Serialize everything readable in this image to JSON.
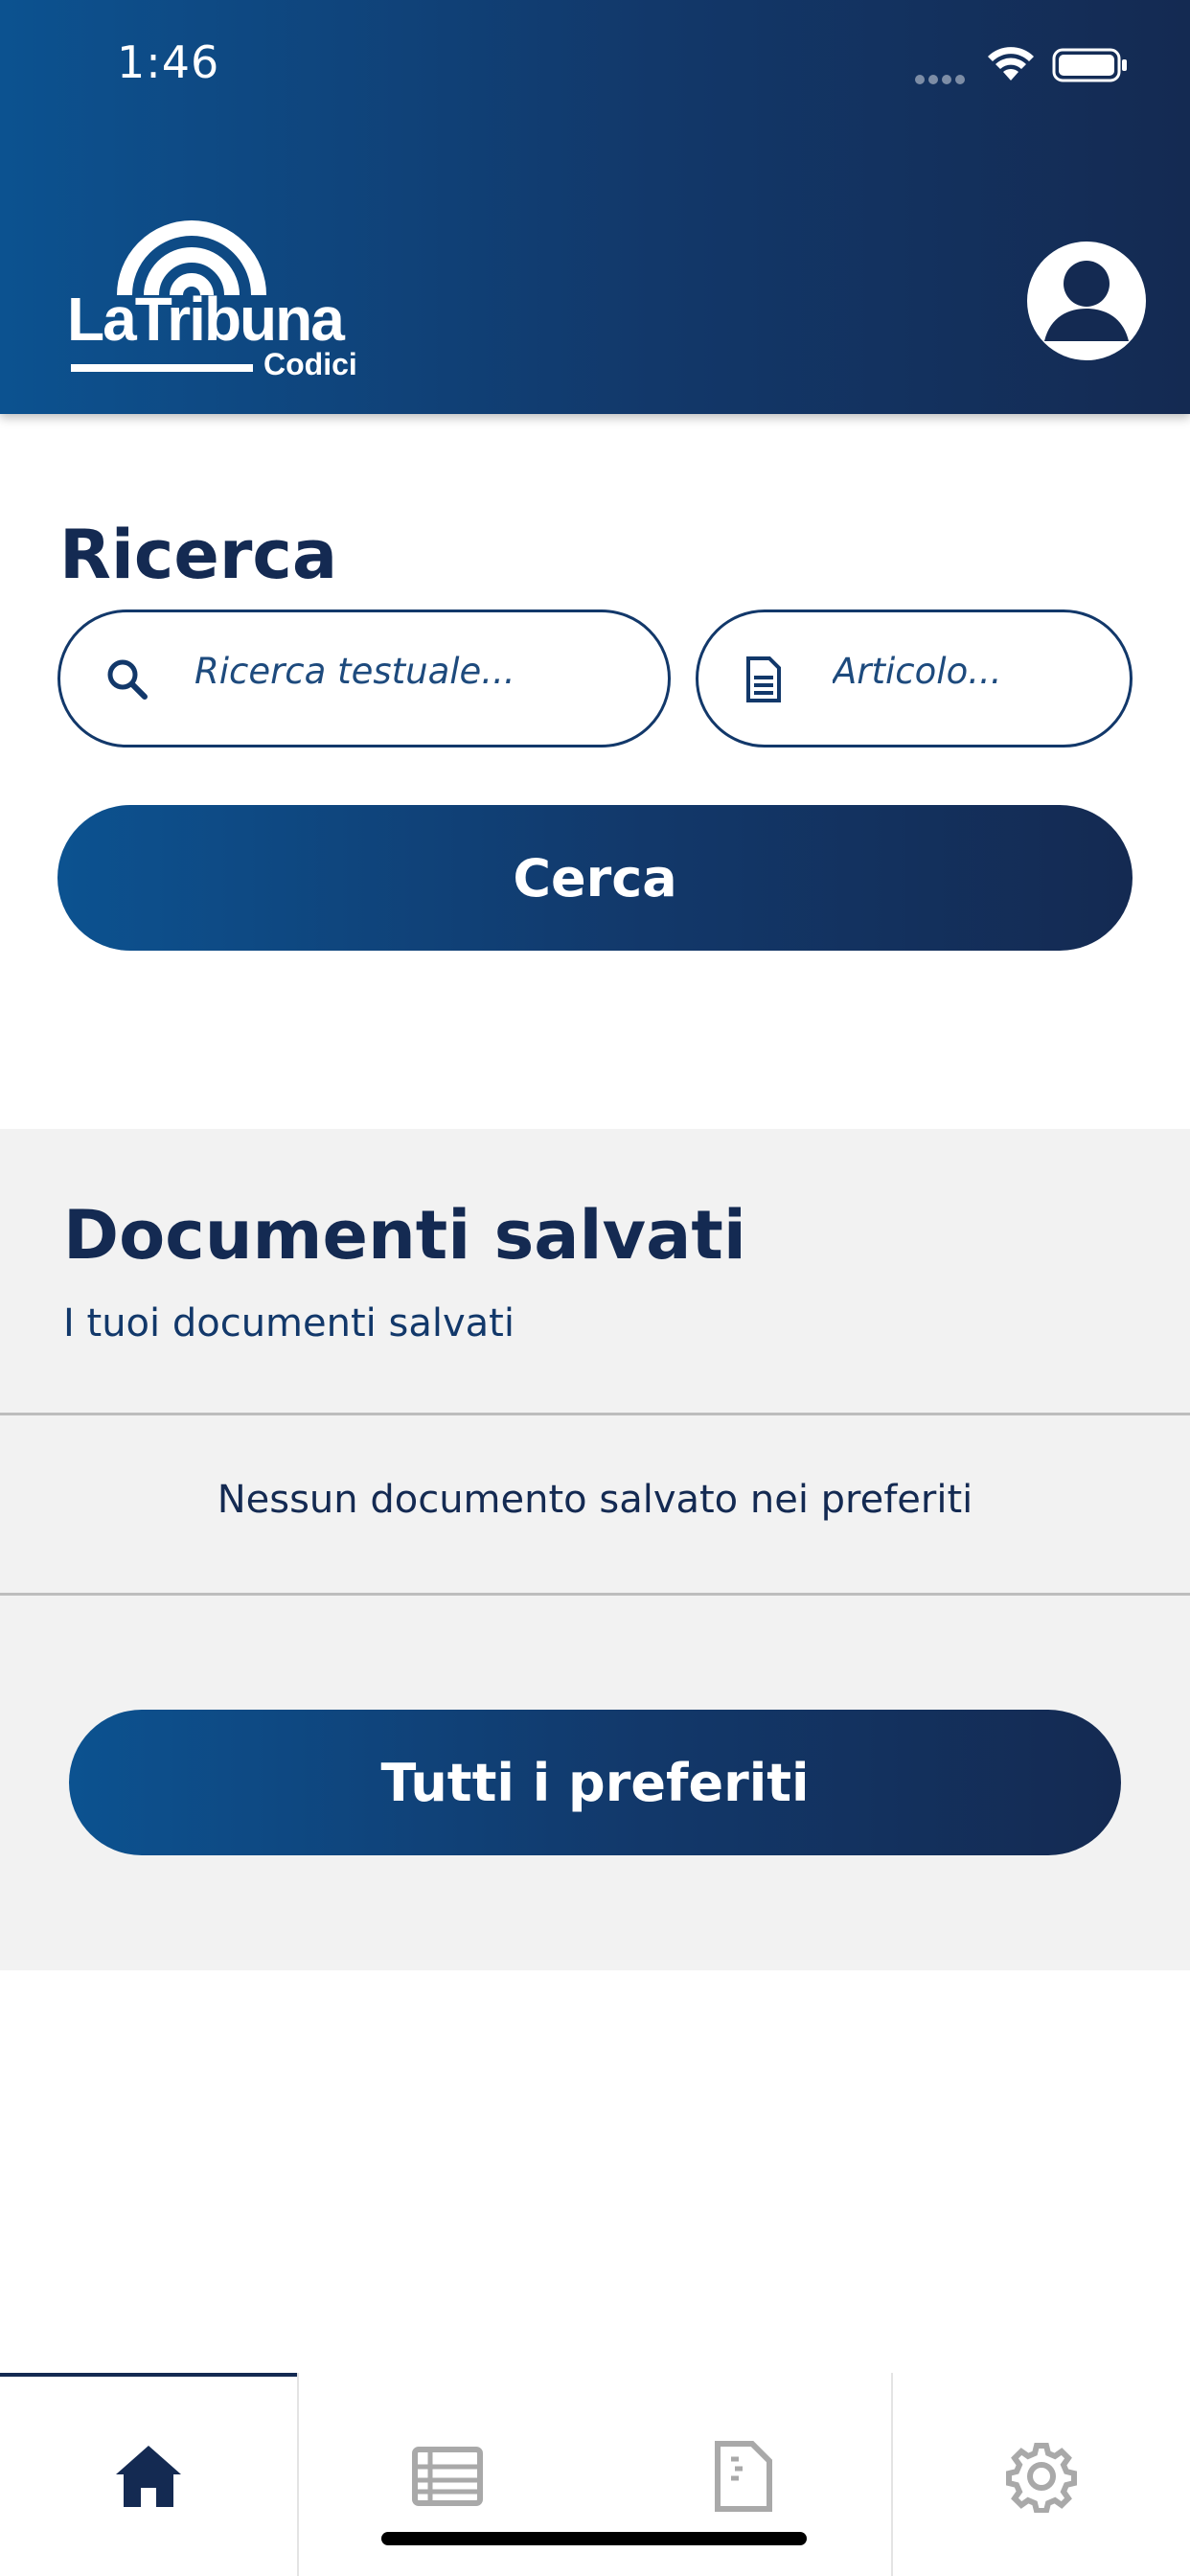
{
  "status_bar": {
    "time": "1:46"
  },
  "header": {
    "logo_main": "LaTribuna",
    "logo_sub": "Codici",
    "profile_icon": "user-circle-icon"
  },
  "search": {
    "title": "Ricerca",
    "text_placeholder": "Ricerca testuale...",
    "article_placeholder": "Articolo...",
    "button_label": "Cerca"
  },
  "saved": {
    "title": "Documenti salvati",
    "subtitle": "I tuoi documenti salvati",
    "empty_message": "Nessun documento salvato nei preferiti",
    "button_label": "Tutti i preferiti"
  },
  "tabbar": {
    "active_index": 0,
    "tabs": [
      {
        "icon": "home-icon"
      },
      {
        "icon": "list-icon"
      },
      {
        "icon": "document-icon"
      },
      {
        "icon": "gear-icon"
      }
    ]
  },
  "colors": {
    "primary": "#12386a",
    "gradient_start": "#0c5290",
    "gradient_end": "#142a52",
    "panel_bg": "#f2f2f2",
    "inactive_icon": "#a9a9a9"
  }
}
